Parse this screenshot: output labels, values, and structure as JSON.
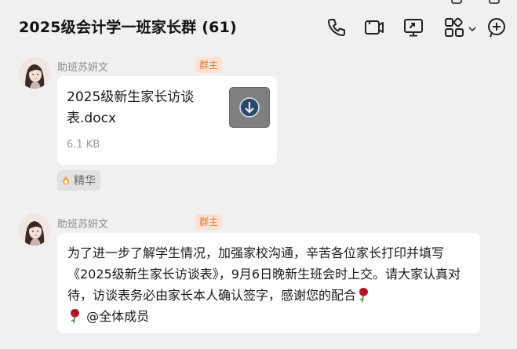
{
  "header": {
    "title": "2025级会计学一班家长群 (61)",
    "icons": [
      "phone-icon",
      "video-call-icon",
      "screen-share-icon",
      "apps-grid-icon",
      "chevron-down-icon",
      "add-circle-icon"
    ]
  },
  "messages": [
    {
      "sender": "助班苏妍文",
      "role": "群主",
      "type": "file",
      "file": {
        "name": "2025级新生家长访谈表.docx",
        "size": "6.1 KB",
        "icon": "word-document-download-icon"
      },
      "tag": "精华"
    },
    {
      "sender": "助班苏妍文",
      "role": "群主",
      "type": "text",
      "text_main": "为了进一步了解学生情况，加强家校沟通，辛苦各位家长打印并填写《2025级新生家长访谈表》，9月6日晚新生班会时上交。请大家认真对待，访谈表务必由家长本人确认签字，感谢您的配合",
      "mention": "@全体成员",
      "emoji": "rose-icon"
    }
  ],
  "colors": {
    "background": "#f1efef",
    "bubble": "#ffffff",
    "role_text": "#e07a3a",
    "role_bg": "#fbe3d3"
  }
}
